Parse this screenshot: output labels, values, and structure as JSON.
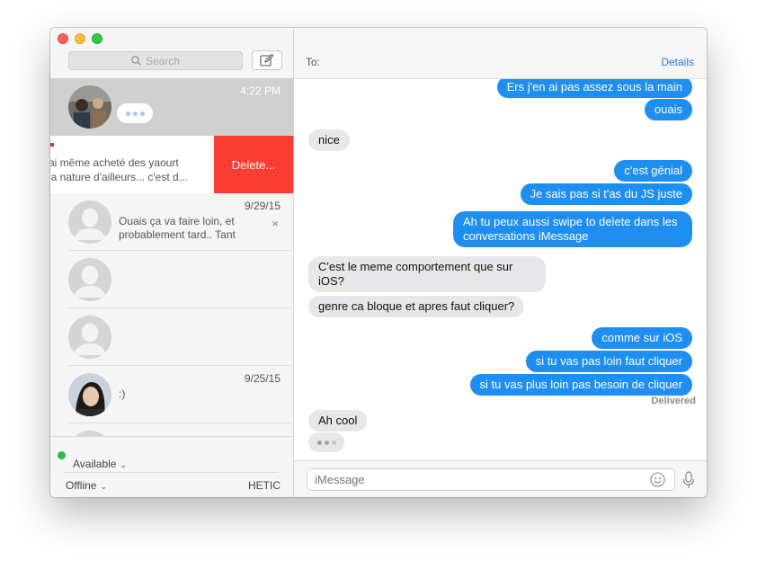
{
  "sidebar": {
    "search_placeholder": "Search",
    "conversations": [
      {
        "time": "4:22 PM",
        "typing": true
      },
      {
        "preview": "J'ai même acheté des yaourt\nnaturels et ja nature d'ailleurs... c'est d...",
        "preview_line1": "ai même acheté des yaourt",
        "preview_line2": "ja nature d'ailleurs... c'est d...",
        "delete_label": "Delete..."
      },
      {
        "name": "",
        "time": "9/29/15",
        "preview": "Ouais ça va faire loin, et probablement tard.. Tant pis,...",
        "close": "×"
      },
      {
        "name": ""
      },
      {
        "name": ""
      },
      {
        "name": "",
        "time": "9/25/15",
        "preview": ":)"
      }
    ],
    "footer": {
      "status": "Available",
      "offline": "Offline",
      "account": "HETIC"
    }
  },
  "chat": {
    "to_label": "To:",
    "details_label": "Details",
    "messages": [
      {
        "dir": "out",
        "text": "Ers j'en ai pas assez sous la main"
      },
      {
        "dir": "out",
        "text": "ouais"
      },
      {
        "dir": "in",
        "text": "nice"
      },
      {
        "dir": "out",
        "text": "c'est génial"
      },
      {
        "dir": "out",
        "text": "Je sais pas si t'as du JS juste"
      },
      {
        "dir": "out",
        "text": "Ah tu peux aussi swipe to delete dans les conversations iMessage"
      },
      {
        "dir": "in",
        "text": "C'est le meme comportement que sur iOS?"
      },
      {
        "dir": "in",
        "text": "genre ca bloque et apres faut cliquer?"
      },
      {
        "dir": "out",
        "text": "comme sur iOS"
      },
      {
        "dir": "out",
        "text": "si tu vas pas loin faut cliquer"
      },
      {
        "dir": "out",
        "text": "si tu vas plus loin pas besoin de cliquer"
      },
      {
        "dir": "in",
        "text": "Ah cool"
      }
    ],
    "delivered_label": "Delivered",
    "composer_placeholder": "iMessage"
  },
  "colors": {
    "accent_blue": "#1f8ef1",
    "delete_red": "#fb3c32",
    "incoming_bubble": "#e7e7ea",
    "status_green": "#2db84b"
  }
}
